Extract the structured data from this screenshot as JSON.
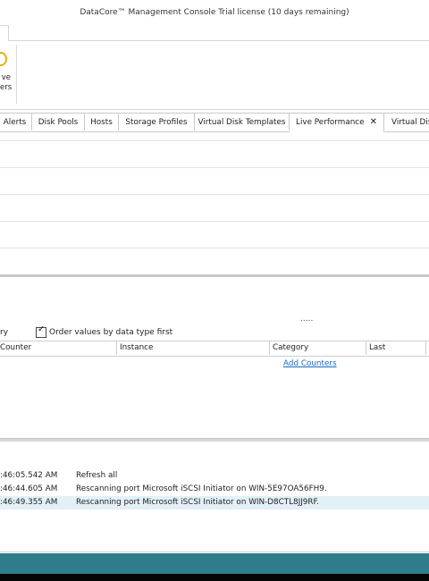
{
  "window": {
    "title": "DataCore™ Management Console   Trial license (10 days remaining)"
  },
  "ribbon": {
    "group_label_line1": "ve",
    "group_label_line2": "ers"
  },
  "tabs": [
    {
      "label": "Alerts"
    },
    {
      "label": "Disk Pools"
    },
    {
      "label": "Hosts"
    },
    {
      "label": "Storage Profiles"
    },
    {
      "label": "Virtual Disk Templates"
    },
    {
      "label": "Live Performance"
    },
    {
      "label": "Virtual Disk"
    }
  ],
  "tab_close_glyph": "✕",
  "options": {
    "left_partial": "ry",
    "order_checkbox_label": "Order values by data type first",
    "order_checked": true
  },
  "performance_table": {
    "columns": [
      "Counter",
      "Instance",
      "Category",
      "Last"
    ],
    "add_counters_link": "Add Counters"
  },
  "splitter_dots": ".....",
  "log": [
    {
      "time": ":46:05.542 AM",
      "message": "Refresh all",
      "selected": false
    },
    {
      "time": ":46:44.605 AM",
      "message": "Rescanning port Microsoft iSCSI Initiator on WIN-5E97OA56FH9.",
      "selected": false
    },
    {
      "time": ":46:49.355 AM",
      "message": "Rescanning port Microsoft iSCSI Initiator on WIN-D8CTL8JJ9RF.",
      "selected": true
    }
  ],
  "colors": {
    "statusbar": "#2f7d8b",
    "link": "#1a67c0",
    "selected_row": "#e3f0f6"
  }
}
